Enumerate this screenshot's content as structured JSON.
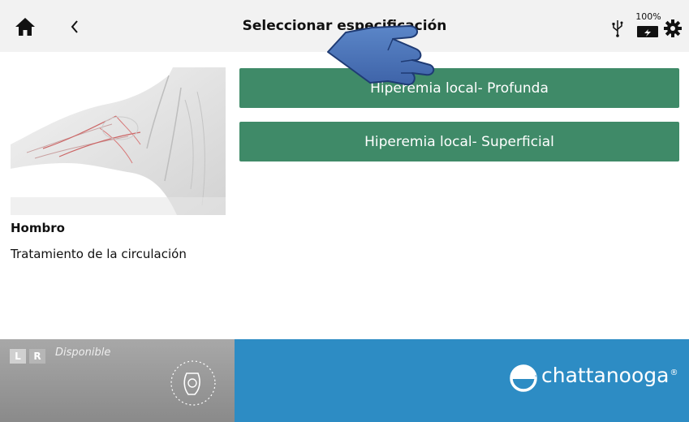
{
  "header": {
    "title": "Seleccionar especificación",
    "battery_percent": "100%"
  },
  "treatment": {
    "region": "Hombro",
    "description": "Tratamiento de la circulación"
  },
  "specifications": [
    {
      "label": "Hiperemia local- Profunda"
    },
    {
      "label": "Hiperemia local- Superficial"
    }
  ],
  "footer": {
    "left_label": "L",
    "right_label": "R",
    "status": "Disponible",
    "brand": "chattanooga",
    "brand_mark": "®"
  },
  "icons": {
    "home": "home-icon",
    "back": "chevron-left-icon",
    "usb": "usb-icon",
    "battery": "battery-charging-icon",
    "settings": "gear-icon",
    "applicator": "applicator-icon",
    "cursor": "hand-pointer-icon",
    "logo": "chattanooga-logo"
  },
  "colors": {
    "button_green": "#3f8a68",
    "footer_blue": "#2d8cc4",
    "header_gray": "#f2f2f2"
  }
}
